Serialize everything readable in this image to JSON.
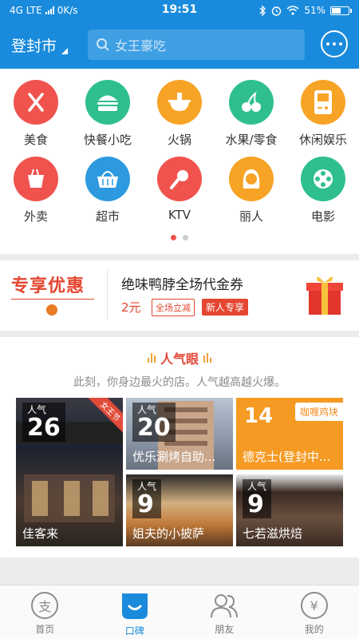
{
  "status_bar": {
    "network": "4G LTE",
    "speed": "0K/s",
    "time": "19:51",
    "battery": "51%",
    "battery_level": 0.51
  },
  "header": {
    "city": "登封市",
    "search_placeholder": "女王豪吃"
  },
  "categories": [
    {
      "label": "美食",
      "icon": "fork-knife-icon",
      "color": "#f0534e"
    },
    {
      "label": "快餐小吃",
      "icon": "burger-icon",
      "color": "#2fbf8e"
    },
    {
      "label": "火锅",
      "icon": "hotpot-icon",
      "color": "#f7a325"
    },
    {
      "label": "水果/零食",
      "icon": "cherry-icon",
      "color": "#2fbf8e"
    },
    {
      "label": "休闲娱乐",
      "icon": "gameboy-icon",
      "color": "#f7a325"
    },
    {
      "label": "外卖",
      "icon": "takeout-box-icon",
      "color": "#f0534e"
    },
    {
      "label": "超市",
      "icon": "basket-icon",
      "color": "#2d9ae0"
    },
    {
      "label": "KTV",
      "icon": "microphone-icon",
      "color": "#f0534e"
    },
    {
      "label": "丽人",
      "icon": "woman-icon",
      "color": "#f7a325"
    },
    {
      "label": "电影",
      "icon": "film-reel-icon",
      "color": "#2fbf8e"
    }
  ],
  "promo": {
    "brand": "专享优惠",
    "title": "绝味鸭脖全场代金券",
    "price": "2元",
    "tag1": "全场立减",
    "tag2": "新人专享"
  },
  "popular": {
    "title": "人气眼",
    "subtitle": "此刻，你身边最火的店。人气越高越火爆。",
    "popularity_label": "人气",
    "items": [
      {
        "rank": "26",
        "name": "佳客来",
        "ribbon": "女王节"
      },
      {
        "rank": "20",
        "name": "优乐涮烤自助..."
      },
      {
        "rank": "14",
        "name": "德克士(登封中...",
        "category": "咖喱鸡块"
      },
      {
        "rank": "9",
        "name": "姐夫的小披萨"
      },
      {
        "rank": "9",
        "name": "七若滋烘焙"
      }
    ]
  },
  "tabbar": {
    "tabs": [
      {
        "label": "首页",
        "icon": "alipay-icon"
      },
      {
        "label": "口碑",
        "icon": "koubei-icon"
      },
      {
        "label": "朋友",
        "icon": "friends-icon"
      },
      {
        "label": "我的",
        "icon": "yuan-icon"
      }
    ]
  }
}
